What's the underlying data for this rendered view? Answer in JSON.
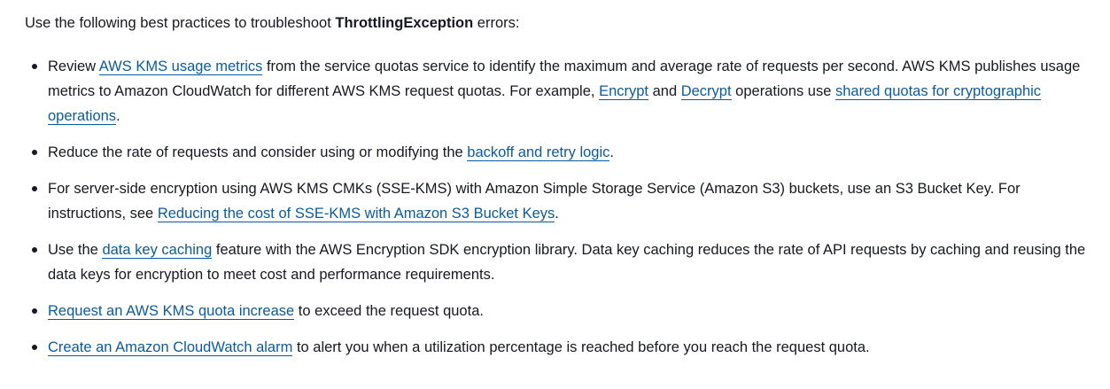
{
  "intro": {
    "prefix": "Use the following best practices to troubleshoot ",
    "emphasis": "ThrottlingException",
    "suffix": " errors:"
  },
  "bullets": [
    {
      "t1": "Review ",
      "link1": "AWS KMS usage metrics",
      "t2": " from the service quotas service to identify the maximum and average rate of requests per second. AWS KMS publishes usage metrics to Amazon CloudWatch for different AWS KMS request quotas. For example, ",
      "link2": "Encrypt",
      "t3": " and ",
      "link3": "Decrypt",
      "t4": " operations use ",
      "link4": "shared quotas for cryptographic operations",
      "t5": "."
    },
    {
      "t1": "Reduce the rate of requests and consider using or modifying the ",
      "link1": "backoff and retry logic",
      "t2": "."
    },
    {
      "t1": "For server-side encryption using AWS KMS CMKs (SSE-KMS) with Amazon Simple Storage Service (Amazon S3) buckets, use an S3 Bucket Key. For instructions, see ",
      "link1": "Reducing the cost of SSE-KMS with Amazon S3 Bucket Keys",
      "t2": "."
    },
    {
      "t1": "Use the ",
      "link1": "data key caching",
      "t2": " feature with the AWS Encryption SDK encryption library. Data key caching reduces the rate of API requests by caching and reusing the data keys for encryption to meet cost and performance requirements."
    },
    {
      "link1": "Request an AWS KMS quota increase",
      "t1": " to exceed the request quota."
    },
    {
      "link1": "Create an Amazon CloudWatch alarm",
      "t1": " to alert you when a utilization percentage is reached before you reach the request quota."
    }
  ]
}
